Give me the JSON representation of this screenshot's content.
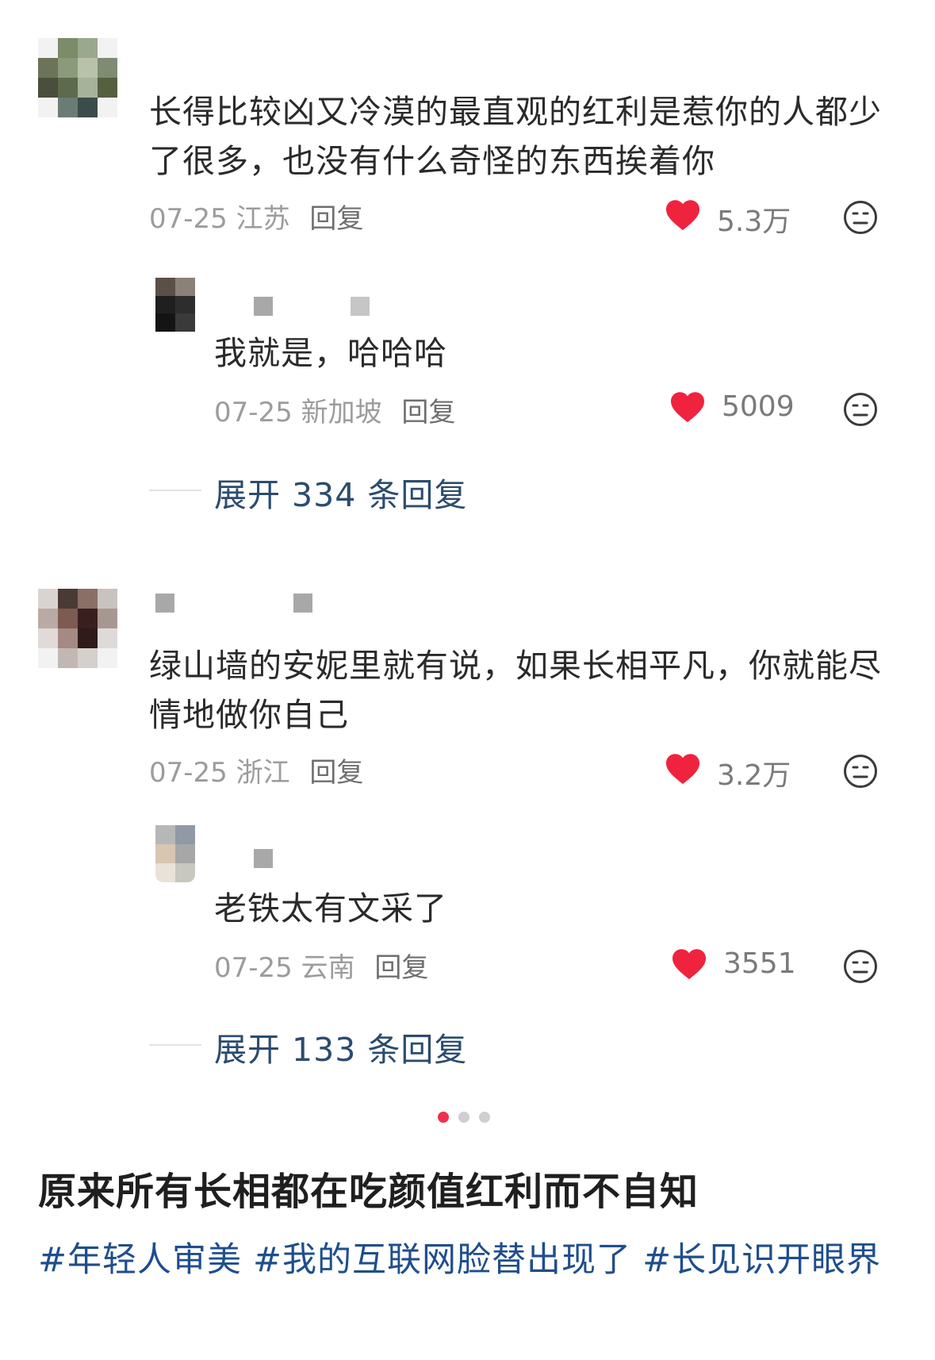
{
  "comments": [
    {
      "text": "长得比较凶又冷漠的最直观的红利是惹你的人都少了很多，也没有什么奇怪的东西挨着你",
      "date": "07-25",
      "location": "江苏",
      "reply_label": "回复",
      "likes": "5.3万",
      "reply": {
        "text": "我就是，哈哈哈",
        "date": "07-25",
        "location": "新加坡",
        "reply_label": "回复",
        "likes": "5009"
      },
      "expand_label": "展开 334 条回复"
    },
    {
      "text": "绿山墙的安妮里就有说，如果长相平凡，你就能尽情地做你自己",
      "date": "07-25",
      "location": "浙江",
      "reply_label": "回复",
      "likes": "3.2万",
      "reply": {
        "text": "老铁太有文采了",
        "date": "07-25",
        "location": "云南",
        "reply_label": "回复",
        "likes": "3551"
      },
      "expand_label": "展开 133 条回复"
    }
  ],
  "pagination": {
    "active_index": 0,
    "count": 3,
    "active_color": "#f0304e",
    "inactive_color": "#cfcfcf"
  },
  "post": {
    "title": "原来所有长相都在吃颜值红利而不自知",
    "tags": [
      "#年轻人审美",
      "#我的互联网脸替出现了",
      "#长见识开眼界"
    ]
  },
  "colors": {
    "heart": "#f0233e",
    "link": "#1f4e8c",
    "meta": "#9c9c9c"
  },
  "icons": {
    "like": "heart-icon",
    "dislike": "neutral-face-icon"
  }
}
